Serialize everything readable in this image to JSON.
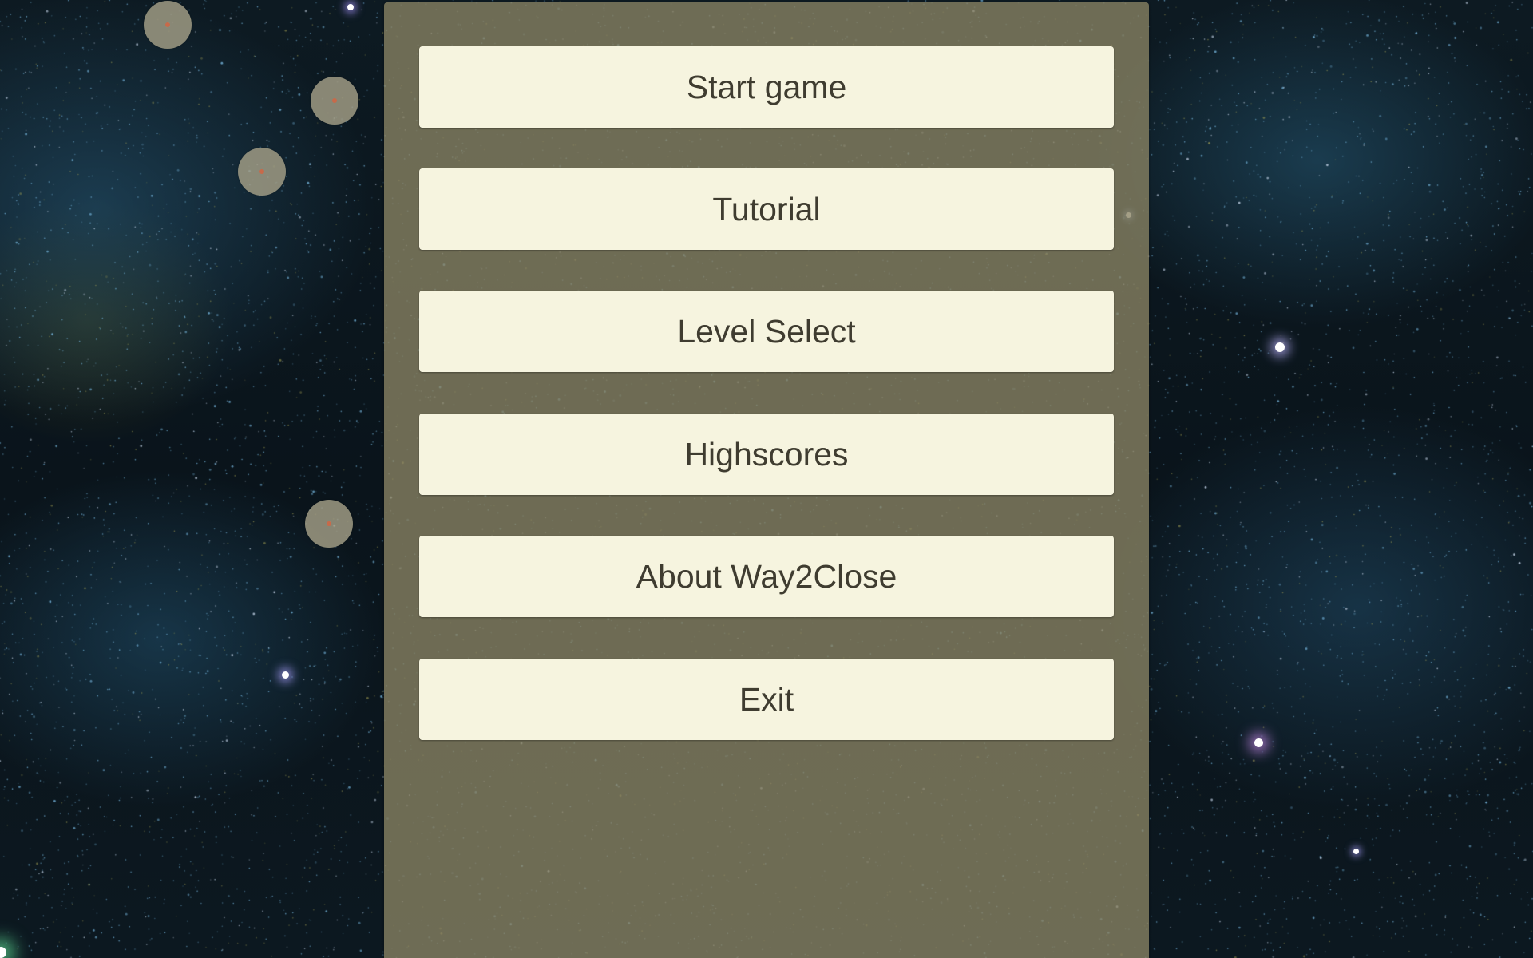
{
  "menu": {
    "buttons": [
      {
        "label": "Start game"
      },
      {
        "label": "Tutorial"
      },
      {
        "label": "Level Select"
      },
      {
        "label": "Highscores"
      },
      {
        "label": "About Way2Close"
      },
      {
        "label": "Exit"
      }
    ]
  },
  "colors": {
    "panel": "#8a8464",
    "button_bg": "#f6f4df",
    "button_text": "#3f3c30",
    "orb": "#a5a087",
    "orb_core": "#c76a4a",
    "space_bg": "#0a141b"
  }
}
